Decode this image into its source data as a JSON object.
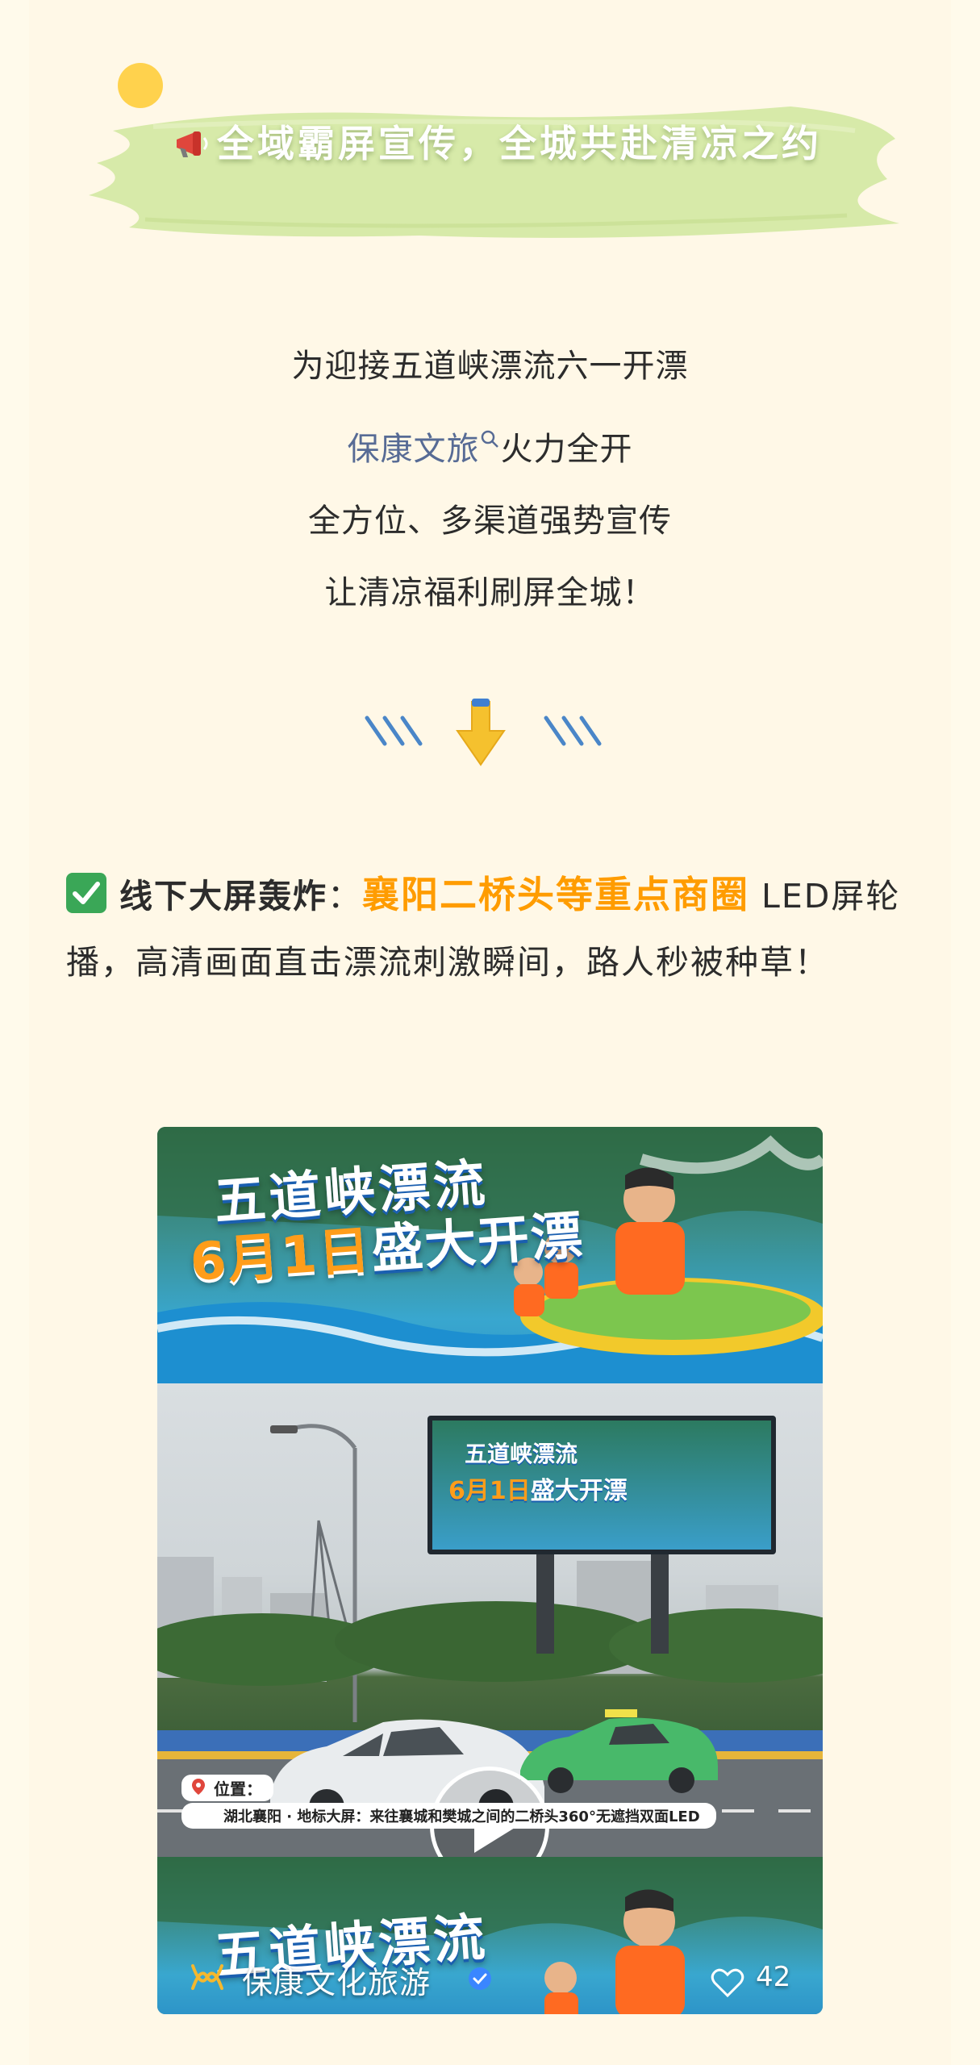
{
  "section_title": {
    "icon": "megaphone-icon",
    "text": "全域霸屏宣传，全城共赴清凉之约"
  },
  "intro": {
    "line1": "为迎接五道峡漂流六一开漂",
    "line2_link": "保康文旅",
    "line2_rest": "火力全开",
    "line3": "全方位、多渠道强势宣传",
    "line4": "让清凉福利刷屏全城！"
  },
  "paragraph": {
    "icon": "check-mark-icon",
    "bold_lead": "线下大屏轰炸",
    "colon": "：",
    "highlight": "襄阳二桥头等重点商圈",
    "rest": " LED屏轮播，高清画面直击漂流刺激瞬间，路人秒被种草！"
  },
  "video": {
    "banner_line1": "五道峡漂流",
    "banner_date": "6月1日",
    "banner_rest": "盛大开漂",
    "billboard_line1": "五道峡漂流",
    "billboard_date": "6月1日",
    "billboard_rest": "盛大开漂",
    "location_label": "位置：",
    "location_desc": "湖北襄阳 · 地标大屏：来往襄城和樊城之间的二桥头360°无遮挡双面LED",
    "channel_name": "保康文化旅游",
    "likes": "42"
  },
  "colors": {
    "background": "#fff8e7",
    "link": "#576b95",
    "highlight": "#ff9c00",
    "brush": "#d4e8a6",
    "check": "#3aa757"
  }
}
